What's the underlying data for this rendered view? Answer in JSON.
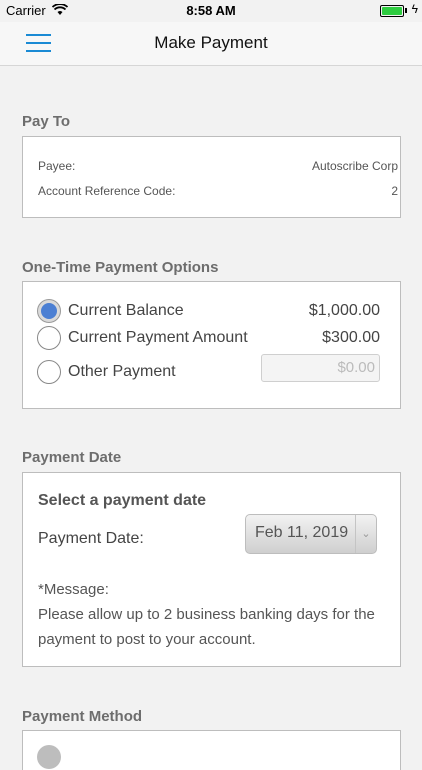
{
  "status_bar": {
    "carrier": "Carrier",
    "time": "8:58 AM",
    "icons": [
      "wifi-icon",
      "battery-icon",
      "charging-bolt-icon"
    ]
  },
  "navbar": {
    "title": "Make Payment",
    "menu_icon": "hamburger-menu-icon"
  },
  "pay_to": {
    "title": "Pay To",
    "rows": [
      {
        "label": "Payee:",
        "value": "Autoscribe Corp"
      },
      {
        "label": "Account Reference Code:",
        "value": "2"
      }
    ]
  },
  "options": {
    "title": "One-Time Payment Options",
    "items": [
      {
        "label": "Current Balance",
        "amount": "$1,000.00",
        "selected": true
      },
      {
        "label": "Current Payment Amount",
        "amount": "$300.00",
        "selected": false
      },
      {
        "label": "Other Payment",
        "placeholder": "$0.00",
        "selected": false
      }
    ]
  },
  "payment_date": {
    "title": "Payment Date",
    "heading": "Select a payment date",
    "label": "Payment Date:",
    "value": "Feb 11, 2019",
    "message_title": "*Message:",
    "message": "Please allow up to 2 business banking days for the payment to post to your account."
  },
  "payment_method": {
    "title": "Payment Method"
  },
  "colors": {
    "accent": "#1a8ad4",
    "radio_selected": "#4b7fd3"
  }
}
